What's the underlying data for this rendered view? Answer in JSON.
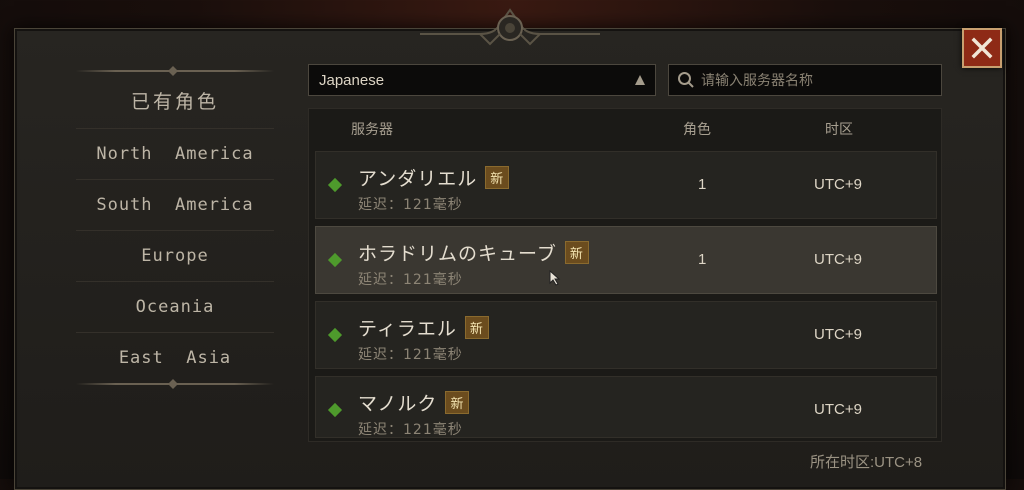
{
  "sidebar": {
    "items": [
      {
        "label": "已有角色"
      },
      {
        "label": "North  America"
      },
      {
        "label": "South  America"
      },
      {
        "label": "Europe"
      },
      {
        "label": "Oceania"
      },
      {
        "label": "East  Asia"
      }
    ]
  },
  "language_select": {
    "value": "Japanese"
  },
  "search": {
    "placeholder": "请输入服务器名称"
  },
  "table": {
    "headers": {
      "server": "服务器",
      "characters": "角色",
      "timezone": "时区"
    },
    "rows": [
      {
        "name": "アンダリエル",
        "badge": "新",
        "latency": "延迟：121毫秒",
        "characters": "1",
        "timezone": "UTC+9",
        "selected": false,
        "status_color": "#4e9a2c"
      },
      {
        "name": "ホラドリムのキューブ",
        "badge": "新",
        "latency": "延迟：121毫秒",
        "characters": "1",
        "timezone": "UTC+9",
        "selected": true,
        "status_color": "#4e9a2c"
      },
      {
        "name": "ティラエル",
        "badge": "新",
        "latency": "延迟：121毫秒",
        "characters": "",
        "timezone": "UTC+9",
        "selected": false,
        "status_color": "#4e9a2c"
      },
      {
        "name": "マノルク",
        "badge": "新",
        "latency": "延迟：121毫秒",
        "characters": "",
        "timezone": "UTC+9",
        "selected": false,
        "status_color": "#4e9a2c"
      }
    ]
  },
  "footer": {
    "timezone_label": "所在时区:UTC+8"
  },
  "icons": {
    "close": "close-icon",
    "search": "search-icon",
    "dropdown": "dropdown-arrow-icon",
    "crest": "crest-ornament-icon"
  },
  "colors": {
    "accent_red": "#8e2a16",
    "status_green": "#4e9a2c",
    "badge_gold": "#6b4c1e"
  }
}
